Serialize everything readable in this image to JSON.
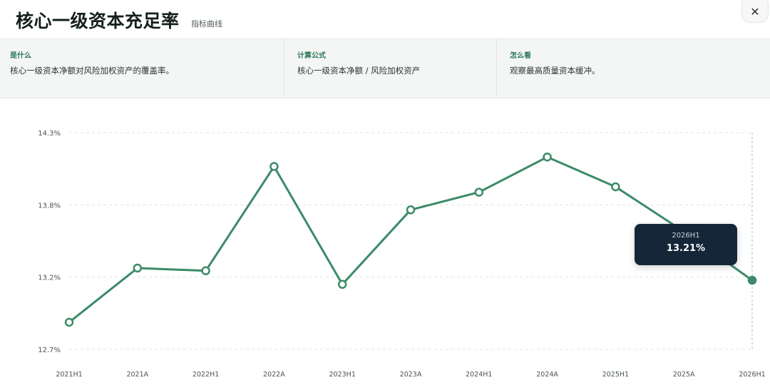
{
  "header": {
    "title": "核心一级资本充足率",
    "subtitle": "指标曲线",
    "close_icon": "close-icon"
  },
  "info": [
    {
      "label": "是什么",
      "text": "核心一级资本净额对风险加权资产的覆盖率。"
    },
    {
      "label": "计算公式",
      "text": "核心一级资本净额 / 风险加权资产"
    },
    {
      "label": "怎么看",
      "text": "观察最高质量资本缓冲。"
    }
  ],
  "tooltip": {
    "x": "2026H1",
    "y": "13.21%"
  },
  "colors": {
    "line": "#3c8a68",
    "accent": "#2f7a5a",
    "tooltip_bg": "#152638"
  },
  "chart_data": {
    "type": "line",
    "categories": [
      "2021H1",
      "2021A",
      "2022H1",
      "2022A",
      "2023H1",
      "2023A",
      "2024H1",
      "2024A",
      "2025H1",
      "2025A",
      "2026H1"
    ],
    "series": [
      {
        "values": [
          12.9,
          13.3,
          13.28,
          14.05,
          13.18,
          13.73,
          13.86,
          14.12,
          13.9,
          13.57,
          13.21
        ]
      }
    ],
    "yticks": [
      "12.7%",
      "13.2%",
      "13.8%",
      "14.3%"
    ],
    "ylim": [
      12.7,
      14.3
    ],
    "grid": true,
    "highlight": "2026H1"
  }
}
